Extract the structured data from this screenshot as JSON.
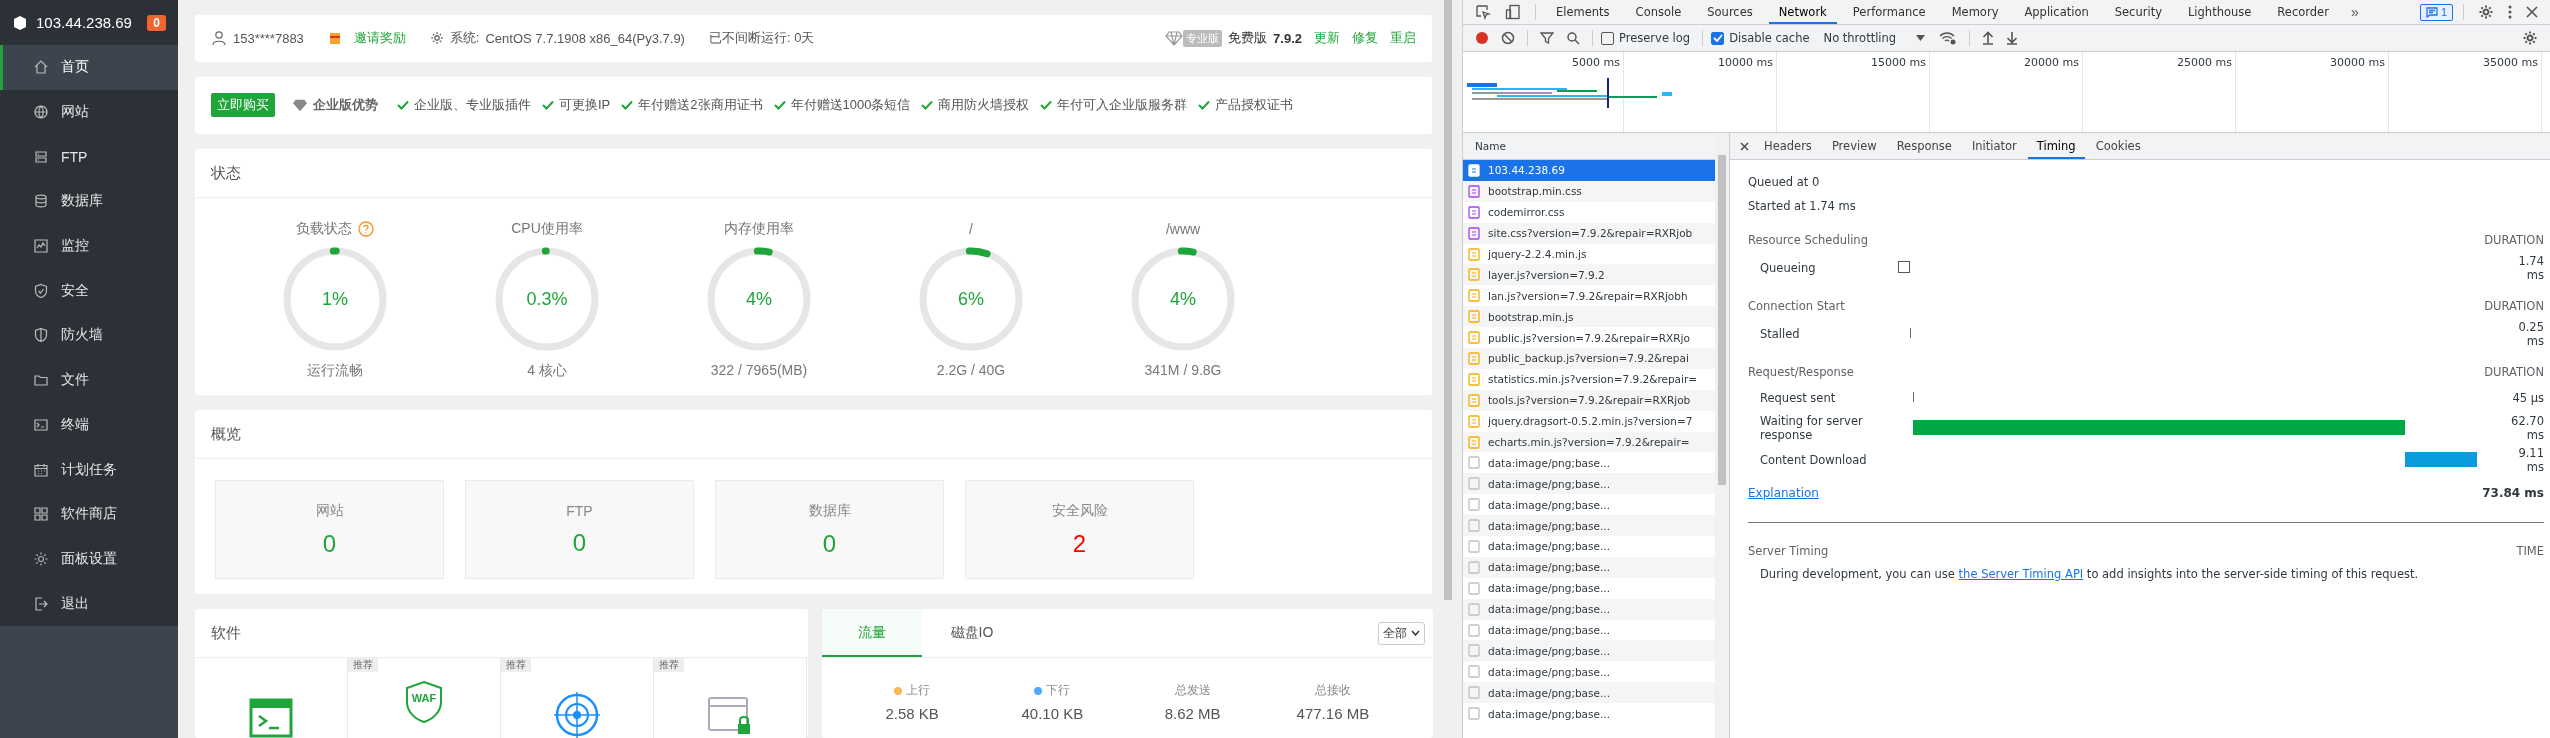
{
  "sidebar": {
    "host": "103.44.238.69",
    "badge": "0",
    "items": [
      {
        "label": "首页",
        "selected": true
      },
      {
        "label": "网站",
        "selected": false
      },
      {
        "label": "FTP",
        "selected": false
      },
      {
        "label": "数据库",
        "selected": false
      },
      {
        "label": "监控",
        "selected": false
      },
      {
        "label": "安全",
        "selected": false
      },
      {
        "label": "防火墙",
        "selected": false
      },
      {
        "label": "文件",
        "selected": false
      },
      {
        "label": "终端",
        "selected": false
      },
      {
        "label": "计划任务",
        "selected": false
      },
      {
        "label": "软件商店",
        "selected": false
      },
      {
        "label": "面板设置",
        "selected": false
      },
      {
        "label": "退出",
        "selected": false
      }
    ]
  },
  "top_bar": {
    "user": "153****7883",
    "invite": "邀请奖励",
    "system_label": "系统:",
    "system": "CentOS 7.7.1908 x86_64(Py3.7.9)",
    "uptime": "已不间断运行: 0天",
    "edition_badge": "专业版",
    "edition": "免费版",
    "version": "7.9.2",
    "actions": [
      "更新",
      "修复",
      "重启"
    ]
  },
  "promo_bar": {
    "buy": "立即购买",
    "title": "企业版优势",
    "features": [
      "企业版、专业版插件",
      "可更换IP",
      "年付赠送2张商用证书",
      "年付赠送1000条短信",
      "商用防火墙授权",
      "年付可入企业版服务群",
      "产品授权证书"
    ]
  },
  "status": {
    "title": "状态",
    "gauges": [
      {
        "label": "负载状态",
        "help": true,
        "value": "1%",
        "level": 0.01,
        "caption": "运行流畅"
      },
      {
        "label": "CPU使用率",
        "help": false,
        "value": "0.3%",
        "level": 0.003,
        "caption": "4 核心"
      },
      {
        "label": "内存使用率",
        "help": false,
        "value": "4%",
        "level": 0.04,
        "caption": "322 / 7965(MB)"
      },
      {
        "label": "/",
        "help": false,
        "value": "6%",
        "level": 0.06,
        "caption": "2.2G / 40G"
      },
      {
        "label": "/www",
        "help": false,
        "value": "4%",
        "level": 0.04,
        "caption": "341M / 9.8G"
      }
    ]
  },
  "overview": {
    "title": "概览",
    "cards": [
      {
        "label": "网站",
        "value": "0",
        "color": "#20a53a"
      },
      {
        "label": "FTP",
        "value": "0",
        "color": "#20a53a"
      },
      {
        "label": "数据库",
        "value": "0",
        "color": "#20a53a"
      },
      {
        "label": "安全风险",
        "value": "2",
        "color": "#ff0000"
      }
    ]
  },
  "software": {
    "title": "软件",
    "items": [
      {
        "kind": "terminal"
      },
      {
        "kind": "waf",
        "badge": "推荐",
        "icon_text": "WAF"
      },
      {
        "kind": "radar",
        "badge": "推荐"
      },
      {
        "kind": "ssl",
        "badge": "推荐"
      }
    ]
  },
  "traffic": {
    "tabs": [
      {
        "label": "流量",
        "selected": true
      },
      {
        "label": "磁盘IO",
        "selected": false
      }
    ],
    "select": "全部",
    "stats": [
      {
        "label": "上行",
        "color": "#f7b851",
        "value": "2.58 KB"
      },
      {
        "label": "下行",
        "color": "#52a9ff",
        "value": "40.10 KB"
      },
      {
        "label": "总发送",
        "value": "8.62 MB"
      },
      {
        "label": "总接收",
        "value": "477.16 MB"
      }
    ]
  },
  "devtools": {
    "tabs": [
      {
        "label": "Elements",
        "selected": false
      },
      {
        "label": "Console",
        "selected": false
      },
      {
        "label": "Sources",
        "selected": false
      },
      {
        "label": "Network",
        "selected": true
      },
      {
        "label": "Performance",
        "selected": false
      },
      {
        "label": "Memory",
        "selected": false
      },
      {
        "label": "Application",
        "selected": false
      },
      {
        "label": "Security",
        "selected": false
      },
      {
        "label": "Lighthouse",
        "selected": false
      },
      {
        "label": "Recorder",
        "selected": false
      }
    ],
    "more": "»",
    "issues": "1",
    "toolbar": {
      "preserve_log": {
        "label": "Preserve log",
        "checked": false
      },
      "disable_cache": {
        "label": "Disable cache",
        "checked": true
      },
      "throttling": "No throttling"
    },
    "overview_ticks": [
      "5000 ms",
      "10000 ms",
      "15000 ms",
      "20000 ms",
      "25000 ms",
      "30000 ms",
      "35000 ms"
    ],
    "requests": {
      "column": "Name",
      "rows": [
        {
          "name": "103.44.238.69",
          "kind": "doc",
          "selected": true
        },
        {
          "name": "bootstrap.min.css",
          "kind": "css",
          "selected": false
        },
        {
          "name": "codemirror.css",
          "kind": "css",
          "selected": false
        },
        {
          "name": "site.css?version=7.9.2&repair=RXRjob",
          "kind": "css",
          "selected": false
        },
        {
          "name": "jquery-2.2.4.min.js",
          "kind": "js",
          "selected": false
        },
        {
          "name": "layer.js?version=7.9.2",
          "kind": "js",
          "selected": false
        },
        {
          "name": "lan.js?version=7.9.2&repair=RXRjobh",
          "kind": "js",
          "selected": false
        },
        {
          "name": "bootstrap.min.js",
          "kind": "js",
          "selected": false
        },
        {
          "name": "public.js?version=7.9.2&repair=RXRjo",
          "kind": "js",
          "selected": false
        },
        {
          "name": "public_backup.js?version=7.9.2&repai",
          "kind": "js",
          "selected": false
        },
        {
          "name": "statistics.min.js?version=7.9.2&repair=",
          "kind": "js",
          "selected": false
        },
        {
          "name": "tools.js?version=7.9.2&repair=RXRjob",
          "kind": "js",
          "selected": false
        },
        {
          "name": "jquery.dragsort-0.5.2.min.js?version=7",
          "kind": "js",
          "selected": false
        },
        {
          "name": "echarts.min.js?version=7.9.2&repair=",
          "kind": "js",
          "selected": false
        },
        {
          "name": "data:image/png;base...",
          "kind": "img",
          "selected": false
        },
        {
          "name": "data:image/png;base...",
          "kind": "img",
          "selected": false
        },
        {
          "name": "data:image/png;base...",
          "kind": "img",
          "selected": false
        },
        {
          "name": "data:image/png;base...",
          "kind": "img",
          "selected": false
        },
        {
          "name": "data:image/png;base...",
          "kind": "img",
          "selected": false
        },
        {
          "name": "data:image/png;base...",
          "kind": "img",
          "selected": false
        },
        {
          "name": "data:image/png;base...",
          "kind": "img",
          "selected": false
        },
        {
          "name": "data:image/png;base...",
          "kind": "img",
          "selected": false
        },
        {
          "name": "data:image/png;base...",
          "kind": "img",
          "selected": false
        },
        {
          "name": "data:image/png;base...",
          "kind": "img",
          "selected": false
        },
        {
          "name": "data:image/png;base...",
          "kind": "img",
          "selected": false
        },
        {
          "name": "data:image/png;base...",
          "kind": "img",
          "selected": false
        },
        {
          "name": "data:image/png;base...",
          "kind": "img",
          "selected": false
        }
      ]
    },
    "detail_tabs": [
      {
        "label": "Headers",
        "selected": false
      },
      {
        "label": "Preview",
        "selected": false
      },
      {
        "label": "Response",
        "selected": false
      },
      {
        "label": "Initiator",
        "selected": false
      },
      {
        "label": "Timing",
        "selected": true
      },
      {
        "label": "Cookies",
        "selected": false
      }
    ],
    "timing": {
      "queued": "Queued at 0",
      "started": "Started at 1.74 ms",
      "sections": [
        {
          "title": "Resource Scheduling",
          "duration_label": "DURATION",
          "rows": [
            {
              "label": "Queueing",
              "kind": "queueing",
              "duration": "1.74 ms"
            }
          ]
        },
        {
          "title": "Connection Start",
          "duration_label": "DURATION",
          "rows": [
            {
              "label": "Stalled",
              "kind": "stalled",
              "duration": "0.25 ms"
            }
          ]
        },
        {
          "title": "Request/Response",
          "duration_label": "DURATION",
          "rows": [
            {
              "label": "Request sent",
              "kind": "sent",
              "duration": "45 µs"
            },
            {
              "label": "Waiting for server response",
              "kind": "waiting",
              "duration": "62.70 ms"
            },
            {
              "label": "Content Download",
              "kind": "download",
              "duration": "9.11 ms"
            }
          ]
        }
      ],
      "explanation": "Explanation",
      "total": "73.84 ms",
      "server_timing": {
        "title": "Server Timing",
        "time_label": "TIME",
        "before": "During development, you can use ",
        "link": "the Server Timing API",
        "after": " to add insights into the server-side timing of this request."
      }
    }
  }
}
